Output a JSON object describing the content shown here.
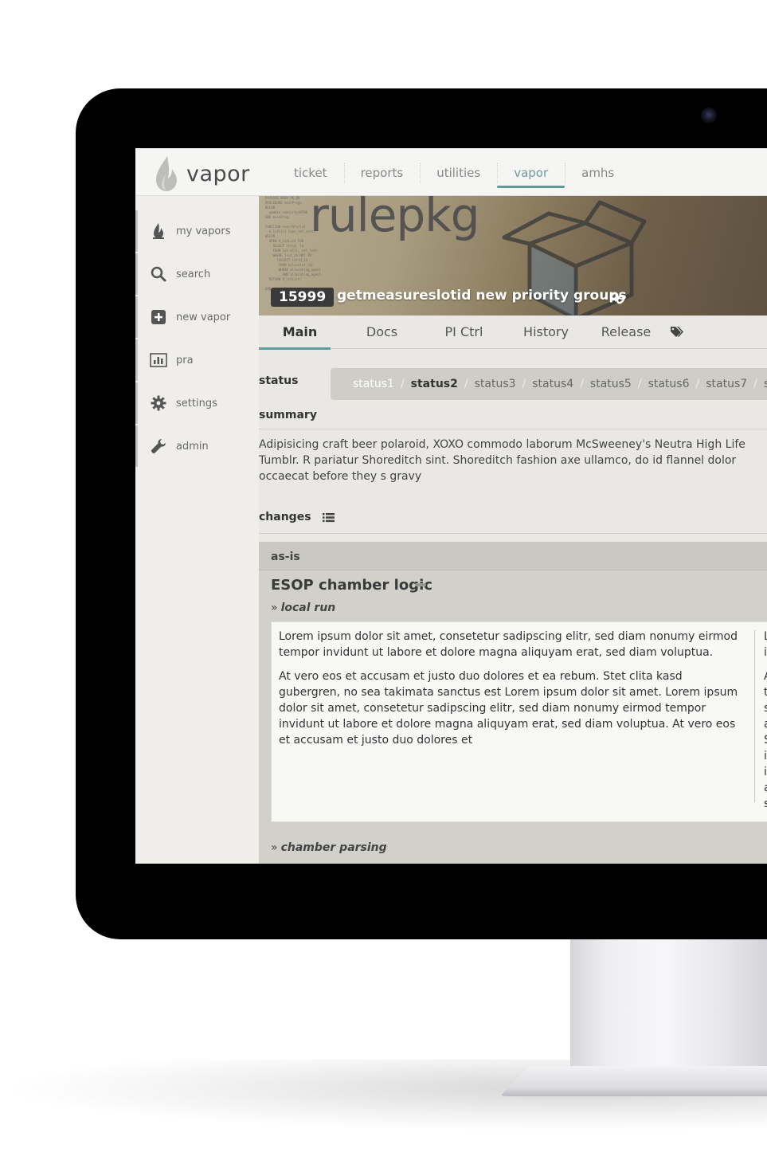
{
  "app": {
    "logo_text": "vapor",
    "nav": [
      "ticket",
      "reports",
      "utilities",
      "vapor",
      "amhs"
    ],
    "active_nav": "vapor",
    "accent_color": "#5d9c98"
  },
  "sidebar": {
    "items": [
      {
        "label": "my vapors",
        "icon": "flame-icon"
      },
      {
        "label": "search",
        "icon": "search-icon"
      },
      {
        "label": "new vapor",
        "icon": "plus-square-icon"
      },
      {
        "label": "pra",
        "icon": "bar-chart-icon"
      },
      {
        "label": "settings",
        "icon": "gear-icon"
      },
      {
        "label": "admin",
        "icon": "wrench-icon"
      }
    ]
  },
  "ticket": {
    "banner_word": "rulepkg",
    "number": "15999",
    "title": "getmeasureslotid new priority groups"
  },
  "tabs": [
    "Main",
    "Docs",
    "PI Ctrl",
    "History",
    "Release"
  ],
  "active_tab": "Main",
  "status": {
    "label": "status",
    "steps": [
      "status1",
      "status2",
      "status3",
      "status4",
      "status5",
      "status6",
      "status7",
      "stat"
    ],
    "done": "status1",
    "current": "status2"
  },
  "summary": {
    "label": "summary",
    "text": "Adipisicing craft beer polaroid, XOXO commodo laborum McSweeney's Neutra High Life Tumblr. R pariatur Shoreditch sint. Shoreditch fashion axe ullamco, do id flannel dolor occaecat before they s gravy"
  },
  "changes": {
    "label": "changes",
    "panel_title": "as-is",
    "section_title": "ESOP chamber logic",
    "subsections": [
      "local run",
      "chamber parsing"
    ],
    "doc_paragraphs": [
      "Lorem ipsum dolor sit amet, consetetur sadipscing elitr, sed diam nonumy eirmod tempor invidunt ut labore et dolore magna aliquyam erat, sed diam voluptua.",
      "At vero eos et accusam et justo duo dolores et ea rebum. Stet clita kasd gubergren, no sea takimata sanctus est Lorem ipsum dolor sit amet. Lorem ipsum dolor sit amet, consetetur sadipscing elitr, sed diam nonumy eirmod tempor invidunt ut labore et dolore magna aliquyam erat, sed diam voluptua. At vero eos et accusam et justo duo dolores et"
    ],
    "doc_col2_letters": [
      "L",
      "i",
      "",
      "A",
      "t",
      "s",
      "a",
      "S",
      "i",
      "i",
      "a",
      "s"
    ]
  }
}
